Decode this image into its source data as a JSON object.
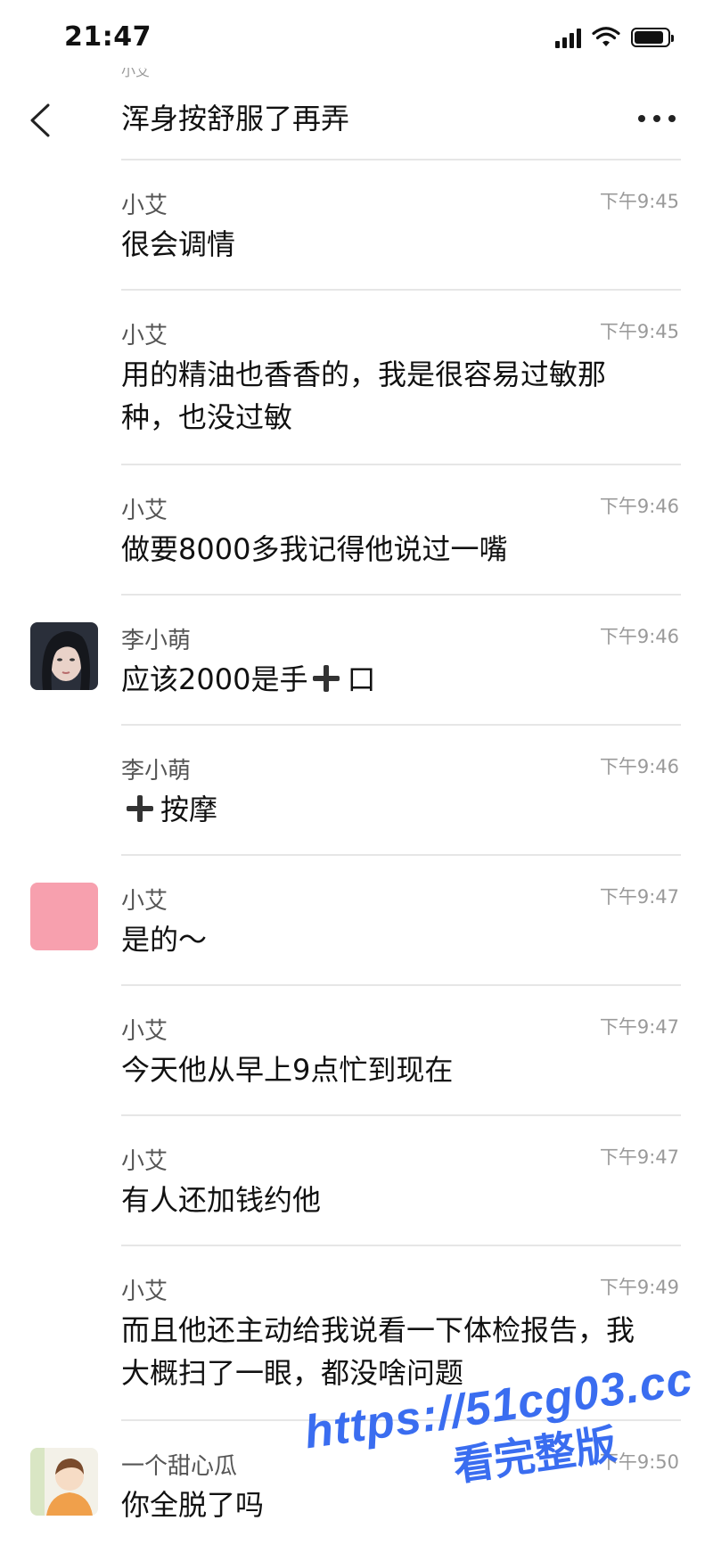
{
  "status_bar": {
    "time": "21:47"
  },
  "header": {
    "partial_above": "小艾",
    "title": "浑身按舒服了再弄"
  },
  "messages": [
    {
      "sender": "小艾",
      "time": "下午9:45",
      "text": "很会调情"
    },
    {
      "sender": "小艾",
      "time": "下午9:45",
      "text_line1": "用的精油也香香的，我是很容易过敏那",
      "text_line2": "种，也没过敏"
    },
    {
      "sender": "小艾",
      "time": "下午9:46",
      "text": "做要8000多我记得他说过一嘴"
    },
    {
      "sender": "李小萌",
      "time": "下午9:46",
      "text_pre": "应该2000是手",
      "text_post": "口"
    },
    {
      "sender": "李小萌",
      "time": "下午9:46",
      "text_post": "按摩"
    },
    {
      "sender": "小艾",
      "time": "下午9:47",
      "text": "是的～"
    },
    {
      "sender": "小艾",
      "time": "下午9:47",
      "text": "今天他从早上9点忙到现在"
    },
    {
      "sender": "小艾",
      "time": "下午9:47",
      "text": "有人还加钱约他"
    },
    {
      "sender": "小艾",
      "time": "下午9:49",
      "text_line1": "而且他还主动给我说看一下体检报告，我",
      "text_line2": "大概扫了一眼，都没啥问题"
    },
    {
      "sender": "一个甜心瓜",
      "time": "下午9:50",
      "text": "你全脱了吗"
    }
  ],
  "icons": [
    "back-chevron-icon",
    "more-dots-icon",
    "signal-icon",
    "wifi-icon",
    "battery-icon",
    "plus-icon"
  ],
  "colors": {
    "pink_avatar": "#f7a0ae",
    "watermark": "#3a6df0"
  },
  "watermark": {
    "url": "https://51cg03.cc",
    "sub": "看完整版"
  }
}
